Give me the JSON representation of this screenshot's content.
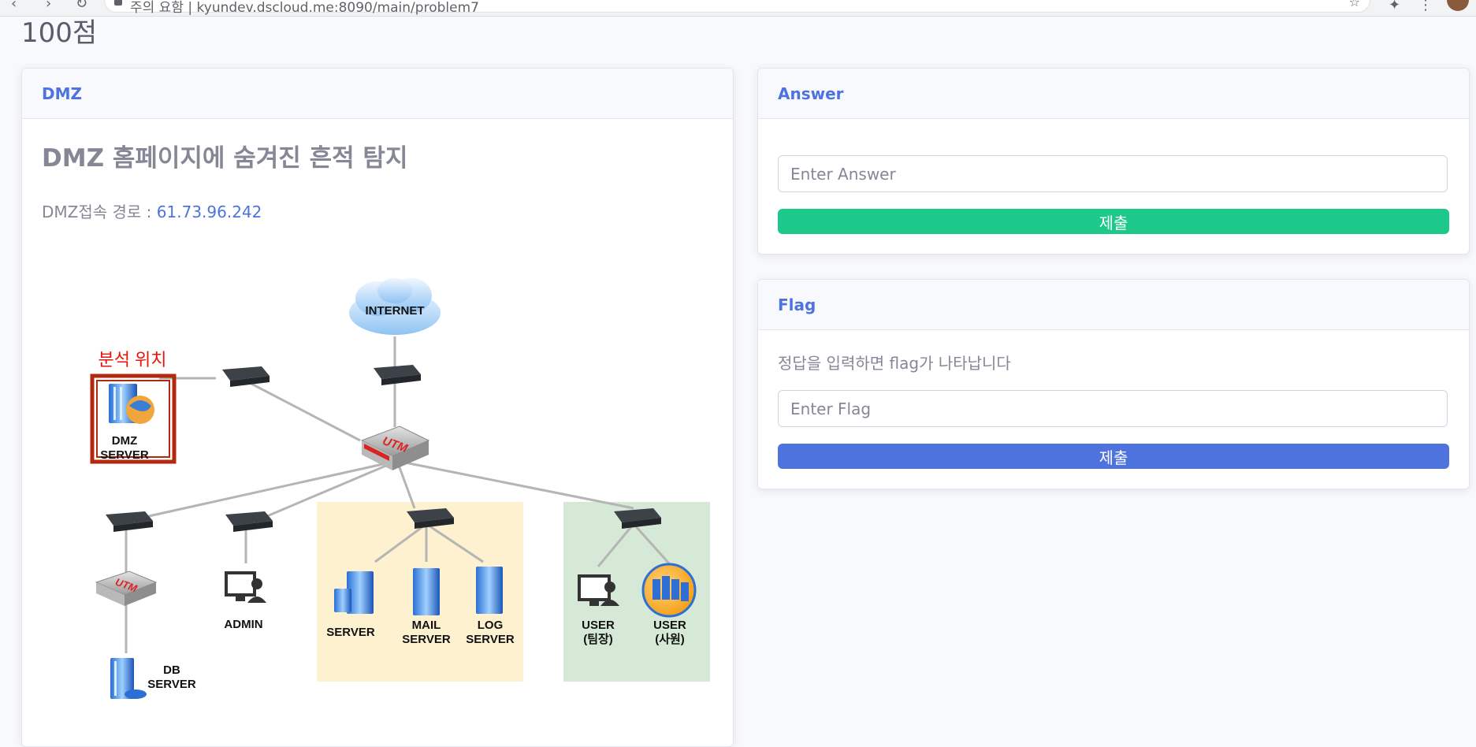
{
  "browser": {
    "url": "kyundev.dscloud.me:8090/main/problem7",
    "security_label": "주의 요함"
  },
  "page": {
    "score_title": "100점"
  },
  "dmz_card": {
    "header": "DMZ",
    "problem_title": "DMZ 홈페이지에 숨겨진 흔적 탐지",
    "route_label": "DMZ접속 경로 : ",
    "route_ip": "61.73.96.242"
  },
  "diagram": {
    "internet_label": "INTERNET",
    "analysis_label": "분석 위치",
    "dmz_server": [
      "DMZ",
      "SERVER"
    ],
    "utm_label": "UTM",
    "admin_label": "ADMIN",
    "db_server": [
      "DB",
      "SERVER"
    ],
    "server_label": "SERVER",
    "mail_server": [
      "MAIL",
      "SERVER"
    ],
    "log_server": [
      "LOG",
      "SERVER"
    ],
    "user_leader": [
      "USER",
      "(팀장)"
    ],
    "user_staff": [
      "USER",
      "(사원)"
    ],
    "colors": {
      "server_zone": "#fdf1cf",
      "user_zone": "#d6e9d6",
      "analysis": "#e8140c",
      "frame": "#b2290f"
    }
  },
  "answer_card": {
    "header": "Answer",
    "placeholder": "Enter Answer",
    "submit_label": "제출"
  },
  "flag_card": {
    "header": "Flag",
    "description": "정답을 입력하면 flag가 나타납니다",
    "placeholder": "Enter Flag",
    "submit_label": "제출"
  }
}
